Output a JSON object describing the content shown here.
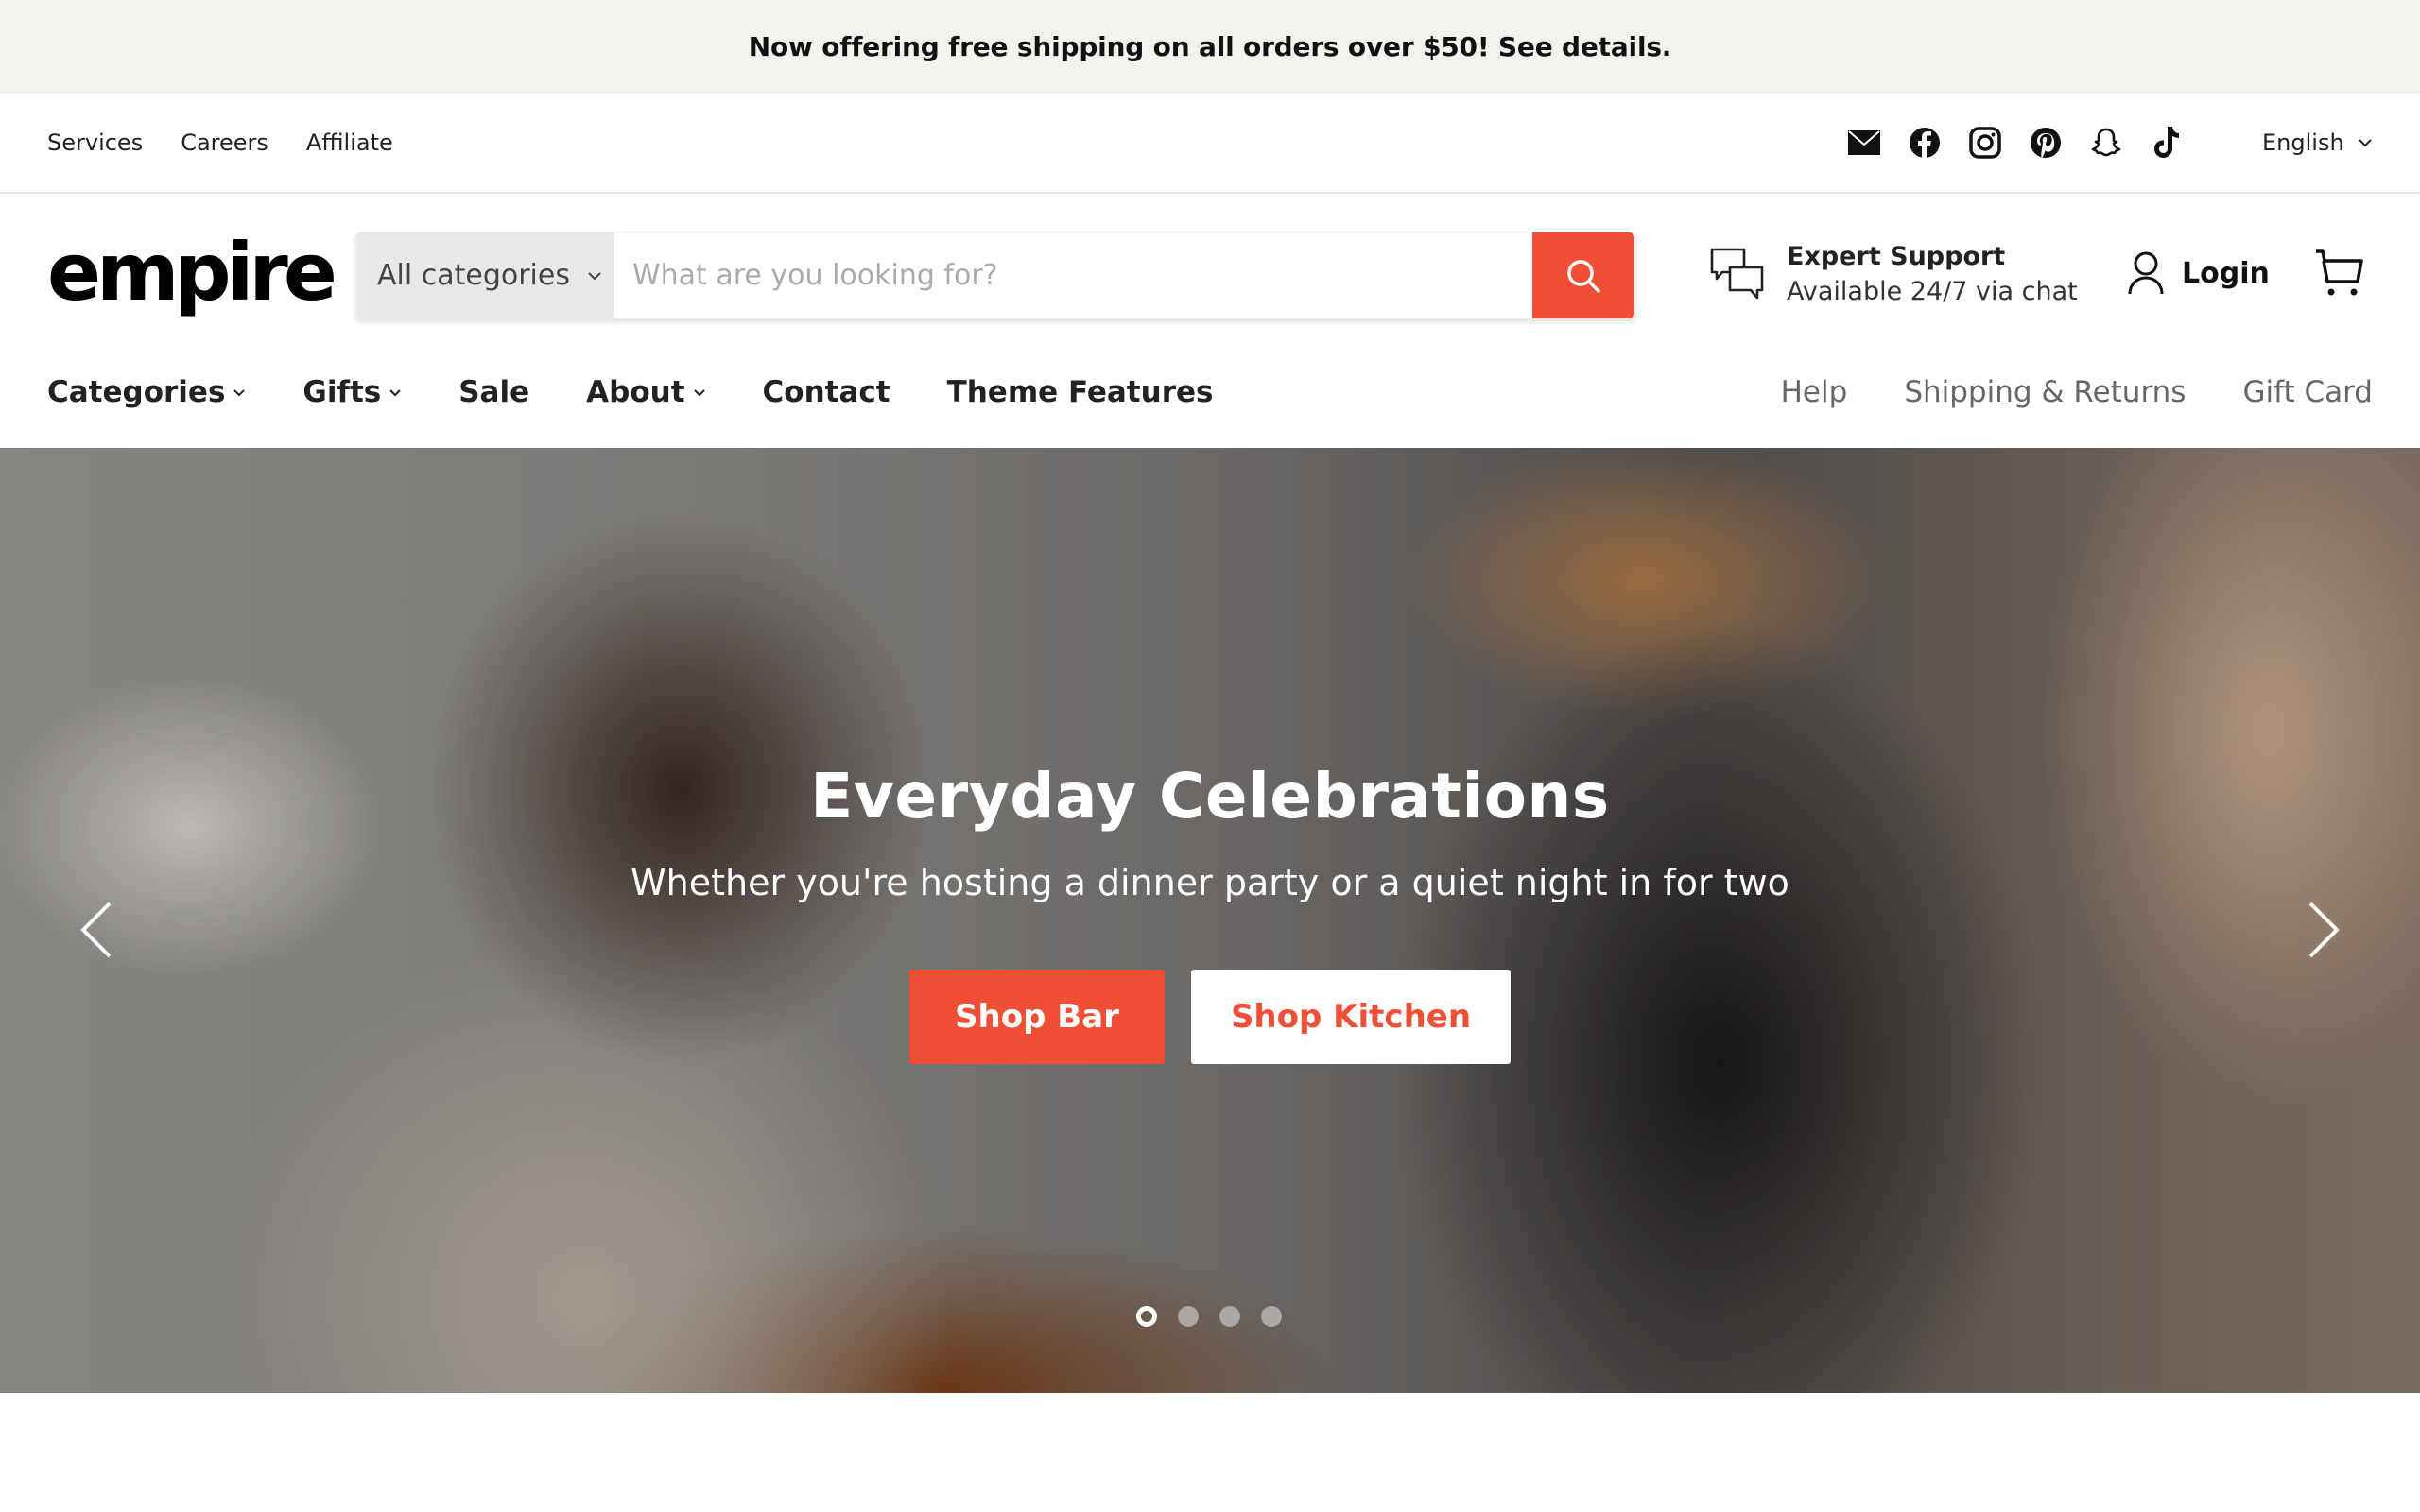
{
  "announcement": "Now offering free shipping on all orders over $50! See details.",
  "utility_nav": {
    "links": [
      "Services",
      "Careers",
      "Affiliate"
    ],
    "socials": [
      "email-icon",
      "facebook-icon",
      "instagram-icon",
      "pinterest-icon",
      "snapchat-icon",
      "tiktok-icon"
    ],
    "language": "English"
  },
  "header": {
    "logo": "empire",
    "search": {
      "category": "All categories",
      "placeholder": "What are you looking for?",
      "value": ""
    },
    "support": {
      "title": "Expert Support",
      "subtitle": "Available 24/7 via chat"
    },
    "login_label": "Login"
  },
  "main_nav": [
    {
      "label": "Categories",
      "dropdown": true
    },
    {
      "label": "Gifts",
      "dropdown": true
    },
    {
      "label": "Sale",
      "dropdown": false
    },
    {
      "label": "About",
      "dropdown": true
    },
    {
      "label": "Contact",
      "dropdown": false
    },
    {
      "label": "Theme Features",
      "dropdown": false
    }
  ],
  "secondary_nav": [
    "Help",
    "Shipping & Returns",
    "Gift Card"
  ],
  "hero": {
    "title": "Everyday Celebrations",
    "subtitle": "Whether you're hosting a dinner party or a quiet night in for two",
    "primary_button": "Shop Bar",
    "secondary_button": "Shop Kitchen",
    "slide_count": 4,
    "active_slide": 1
  },
  "colors": {
    "accent": "#f04f36",
    "announcement_bg": "#f3f2ee",
    "secondary_nav_text": "#666666"
  }
}
